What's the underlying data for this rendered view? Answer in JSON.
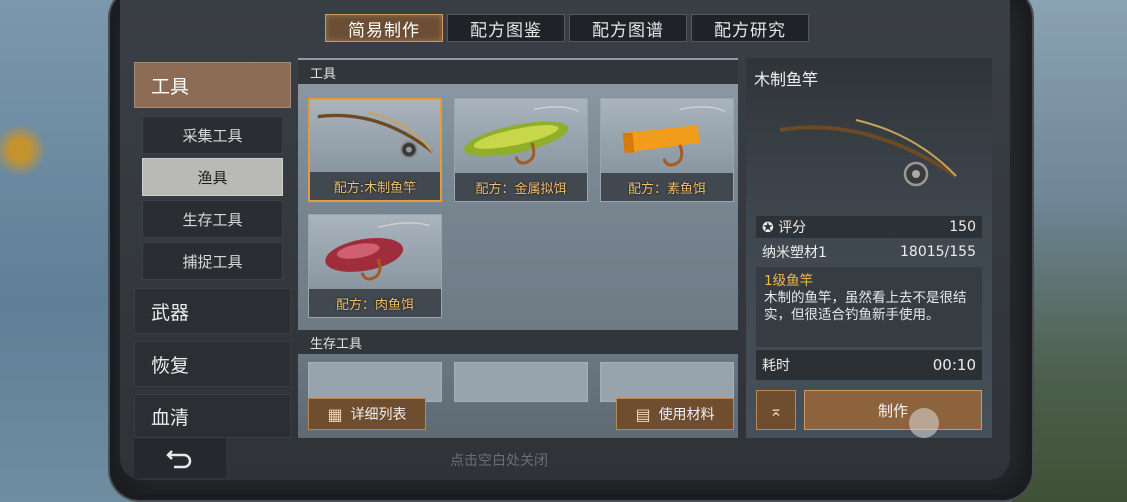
{
  "tabs": [
    "简易制作",
    "配方图鉴",
    "配方图谱",
    "配方研究"
  ],
  "sidebar": {
    "categories": [
      {
        "label": "工具",
        "active": true
      },
      {
        "label": "武器"
      },
      {
        "label": "恢复"
      },
      {
        "label": "血清"
      }
    ],
    "subcategories": [
      {
        "label": "采集工具"
      },
      {
        "label": "渔具",
        "active": true
      },
      {
        "label": "生存工具"
      },
      {
        "label": "捕捉工具"
      }
    ]
  },
  "back_icon": "undo-arrow-icon",
  "close_hint": "点击空白处关闭",
  "recipes": {
    "section_tools": "工具",
    "section_survival": "生存工具",
    "cards": [
      {
        "label": "配方:木制鱼竿",
        "icon": "fishing-rod-icon",
        "selected": true
      },
      {
        "label": "配方：金属拟饵",
        "icon": "metal-lure-icon"
      },
      {
        "label": "配方：素鱼饵",
        "icon": "veggie-bait-icon"
      },
      {
        "label": "配方：肉鱼饵",
        "icon": "meat-bait-icon"
      }
    ],
    "detail_list_button": "详细列表",
    "use_materials_button": "使用材料"
  },
  "detail": {
    "title": "木制鱼竿",
    "score_label": "评分",
    "score_value": "150",
    "material_name": "纳米塑材1",
    "material_count": "18015/155",
    "level": "1级鱼竿",
    "description": "木制的鱼竿，虽然看上去不是很结实，但很适合钓鱼新手使用。",
    "time_label": "耗时",
    "time_value": "00:10",
    "craft_button": "制作"
  },
  "colors": {
    "accent": "#8c6c55",
    "selected_border": "#e69a3a",
    "label_gold": "#f0c070",
    "level_gold": "#f0b94a"
  }
}
